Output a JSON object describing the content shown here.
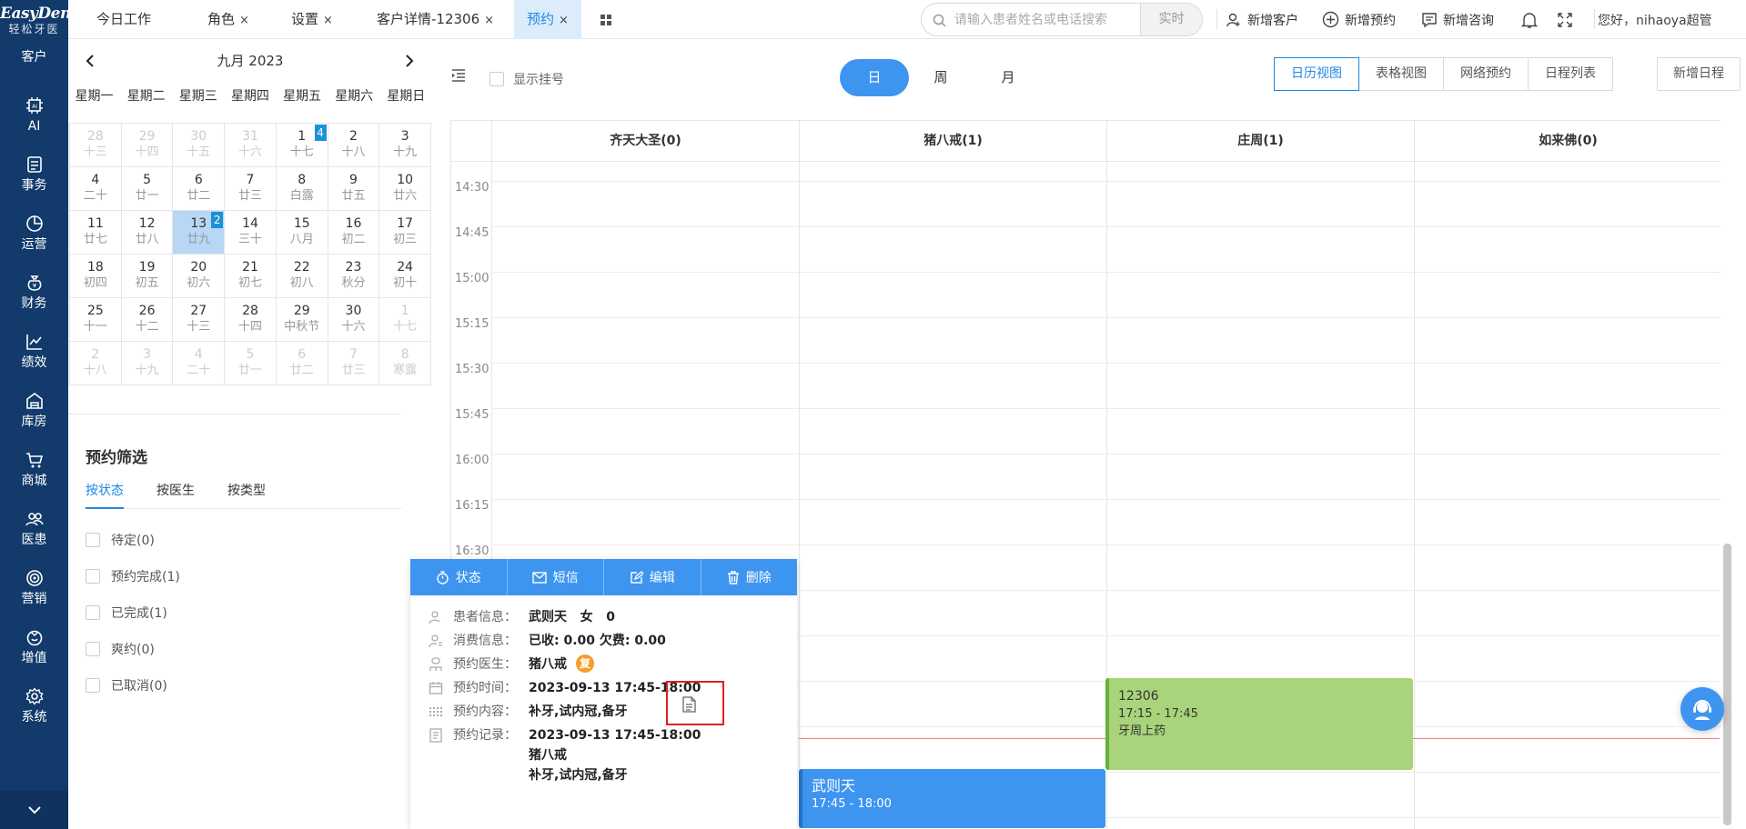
{
  "sidebar": {
    "logo_line1": "EasyDent",
    "logo_line2": "轻松牙医",
    "items": [
      {
        "label": "客户",
        "icon": "user-icon"
      },
      {
        "label": "AI",
        "icon": "ai-chip-icon"
      },
      {
        "label": "事务",
        "icon": "task-icon"
      },
      {
        "label": "运营",
        "icon": "pie-chart-icon"
      },
      {
        "label": "财务",
        "icon": "money-bag-icon"
      },
      {
        "label": "绩效",
        "icon": "line-chart-icon"
      },
      {
        "label": "库房",
        "icon": "warehouse-icon"
      },
      {
        "label": "商城",
        "icon": "cart-icon"
      },
      {
        "label": "医患",
        "icon": "people-icon"
      },
      {
        "label": "营销",
        "icon": "target-icon"
      },
      {
        "label": "增值",
        "icon": "gift-icon"
      },
      {
        "label": "系统",
        "icon": "gear-icon"
      }
    ]
  },
  "topbar": {
    "tabs": [
      {
        "label": "今日工作",
        "closable": false
      },
      {
        "label": "角色",
        "closable": true
      },
      {
        "label": "设置",
        "closable": true
      },
      {
        "label": "客户详情-12306",
        "closable": true
      },
      {
        "label": "预约",
        "closable": true,
        "active": true
      }
    ],
    "close_glyph": "×",
    "search_placeholder": "请输入患者姓名或电话搜索",
    "search_value": "",
    "search_mode": "实时",
    "actions": [
      "新增客户",
      "新增预约",
      "新增咨询"
    ],
    "greeting": "您好，nihaoya超管"
  },
  "calendar": {
    "title": "九月 2023",
    "weekdays": [
      "星期一",
      "星期二",
      "星期三",
      "星期四",
      "星期五",
      "星期六",
      "星期日"
    ],
    "weeks": [
      [
        {
          "d": "28",
          "l": "十三",
          "other": true
        },
        {
          "d": "29",
          "l": "十四",
          "other": true
        },
        {
          "d": "30",
          "l": "十五",
          "other": true
        },
        {
          "d": "31",
          "l": "十六",
          "other": true
        },
        {
          "d": "1",
          "l": "十七",
          "badge": "4"
        },
        {
          "d": "2",
          "l": "十八"
        },
        {
          "d": "3",
          "l": "十九"
        }
      ],
      [
        {
          "d": "4",
          "l": "二十"
        },
        {
          "d": "5",
          "l": "廿一"
        },
        {
          "d": "6",
          "l": "廿二"
        },
        {
          "d": "7",
          "l": "廿三"
        },
        {
          "d": "8",
          "l": "白露"
        },
        {
          "d": "9",
          "l": "廿五"
        },
        {
          "d": "10",
          "l": "廿六"
        }
      ],
      [
        {
          "d": "11",
          "l": "廿七"
        },
        {
          "d": "12",
          "l": "廿八"
        },
        {
          "d": "13",
          "l": "廿九",
          "selected": true,
          "badge": "2"
        },
        {
          "d": "14",
          "l": "三十"
        },
        {
          "d": "15",
          "l": "八月"
        },
        {
          "d": "16",
          "l": "初二"
        },
        {
          "d": "17",
          "l": "初三"
        }
      ],
      [
        {
          "d": "18",
          "l": "初四"
        },
        {
          "d": "19",
          "l": "初五"
        },
        {
          "d": "20",
          "l": "初六"
        },
        {
          "d": "21",
          "l": "初七"
        },
        {
          "d": "22",
          "l": "初八"
        },
        {
          "d": "23",
          "l": "秋分"
        },
        {
          "d": "24",
          "l": "初十"
        }
      ],
      [
        {
          "d": "25",
          "l": "十一"
        },
        {
          "d": "26",
          "l": "十二"
        },
        {
          "d": "27",
          "l": "十三"
        },
        {
          "d": "28",
          "l": "十四"
        },
        {
          "d": "29",
          "l": "中秋节"
        },
        {
          "d": "30",
          "l": "十六"
        },
        {
          "d": "1",
          "l": "十七",
          "other": true
        }
      ],
      [
        {
          "d": "2",
          "l": "十八",
          "other": true
        },
        {
          "d": "3",
          "l": "十九",
          "other": true
        },
        {
          "d": "4",
          "l": "二十",
          "other": true
        },
        {
          "d": "5",
          "l": "廿一",
          "other": true
        },
        {
          "d": "6",
          "l": "廿二",
          "other": true
        },
        {
          "d": "7",
          "l": "廿三",
          "other": true
        },
        {
          "d": "8",
          "l": "寒露",
          "other": true
        }
      ]
    ]
  },
  "filter": {
    "title": "预约筛选",
    "tabs": [
      "按状态",
      "按医生",
      "按类型"
    ],
    "statuses": [
      "待定(0)",
      "预约完成(1)",
      "已完成(1)",
      "爽约(0)",
      "已取消(0)"
    ]
  },
  "toolbar": {
    "show_registration": "显示挂号",
    "segments": [
      "日",
      "周",
      "月"
    ],
    "active_segment": "日",
    "views": [
      "日历视图",
      "表格视图",
      "网络预约",
      "日程列表"
    ],
    "active_view": "日历视图",
    "new_schedule": "新增日程"
  },
  "schedule": {
    "doctors": [
      "齐天大圣(0)",
      "猪八戒(1)",
      "庄周(1)",
      "如来佛(0)"
    ],
    "times": [
      "14:30",
      "14:45",
      "15:00",
      "15:15",
      "15:30",
      "15:45",
      "16:00",
      "16:15",
      "16:30"
    ],
    "events": [
      {
        "title": "12306",
        "time": "17:15 - 17:45",
        "note": "牙周上药",
        "color": "#a9d47b"
      },
      {
        "title": "武则天",
        "time": "17:45 - 18:00",
        "color": "#3d95f0"
      }
    ],
    "now_line_color": "#f08080"
  },
  "popup": {
    "actions": [
      "状态",
      "短信",
      "编辑",
      "删除"
    ],
    "rows": [
      {
        "label": "患者信息：",
        "value": "武则天   女   0",
        "icon": "patient-icon"
      },
      {
        "label": "消费信息：",
        "value": "已收: 0.00 欠费: 0.00",
        "icon": "billing-icon"
      },
      {
        "label": "预约医生：",
        "value": "猪八戒",
        "icon": "doctor-icon",
        "tag": "复"
      },
      {
        "label": "预约时间：",
        "value": "2023-09-13 17:45-18:00",
        "icon": "calendar-icon"
      },
      {
        "label": "预约内容：",
        "value": "补牙,试内冠,备牙",
        "icon": "grid-dots-icon"
      },
      {
        "label": "预约记录：",
        "value": "2023-09-13 17:45-18:00",
        "value2": "猪八戒",
        "value3": "补牙,试内冠,备牙",
        "icon": "record-icon"
      }
    ]
  }
}
